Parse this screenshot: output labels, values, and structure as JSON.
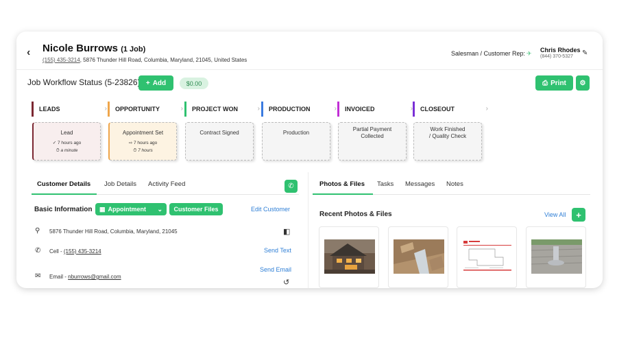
{
  "header": {
    "back_icon": "chevron-left-icon",
    "customer_name": "Nicole Burrows",
    "job_count": "(1 Job)",
    "phone": "(155) 435-3214",
    "address": ", 5876 Thunder Hill Road, Columbia, Maryland, 21045, United States",
    "rep_label": "Salesman / Customer Rep:",
    "rep_name": "Chris Rhodes",
    "rep_phone": "(844) 370-5327"
  },
  "workflow": {
    "title": "Job Workflow Status (5-23826)",
    "add_label": "Add",
    "amount": "$0.00",
    "print_label": "Print",
    "stages": [
      {
        "label": "LEADS",
        "color": "#7b2731"
      },
      {
        "label": "OPPORTUNITY",
        "color": "#efa64b"
      },
      {
        "label": "PROJECT WON",
        "color": "#2fc170"
      },
      {
        "label": "PRODUCTION",
        "color": "#3b7be0"
      },
      {
        "label": "INVOICED",
        "color": "#c12fd6"
      },
      {
        "label": "CLOSEOUT",
        "color": "#7a2fd6"
      }
    ],
    "tiles": [
      {
        "title": "Lead",
        "line1": "7 hours ago",
        "line2": "a minute"
      },
      {
        "title": "Appointment Set",
        "line1": "7 hours ago",
        "line2": "7 hours"
      },
      {
        "title": "Contract Signed"
      },
      {
        "title": "Production"
      },
      {
        "title": "Partial Payment",
        "title2": "Collected"
      },
      {
        "title": "Work Finished",
        "title2": "/ Quality Check"
      }
    ]
  },
  "left_tabs": [
    "Customer Details",
    "Job Details",
    "Activity Feed"
  ],
  "right_tabs": [
    "Photos & Files",
    "Tasks",
    "Messages",
    "Notes"
  ],
  "basic_info": {
    "title": "Basic Information",
    "appointment_label": "Appointment",
    "customer_files_label": "Customer Files",
    "edit_label": "Edit Customer",
    "address": "5876 Thunder Hill Road, Columbia, Maryland, 21045",
    "cell_prefix": "Cell - ",
    "cell": "(155) 435-3214",
    "send_text": "Send Text",
    "email_prefix": "Email - ",
    "email": "nburrows@gmail.com",
    "send_email": "Send Email"
  },
  "photos": {
    "title": "Recent Photos & Files",
    "view_all": "View All",
    "items": [
      "house-photo",
      "roof-shingles-photo",
      "quick-measure-report",
      "roof-vent-photo"
    ]
  },
  "colors": {
    "accent": "#2fc170",
    "link": "#2f7fd6"
  }
}
